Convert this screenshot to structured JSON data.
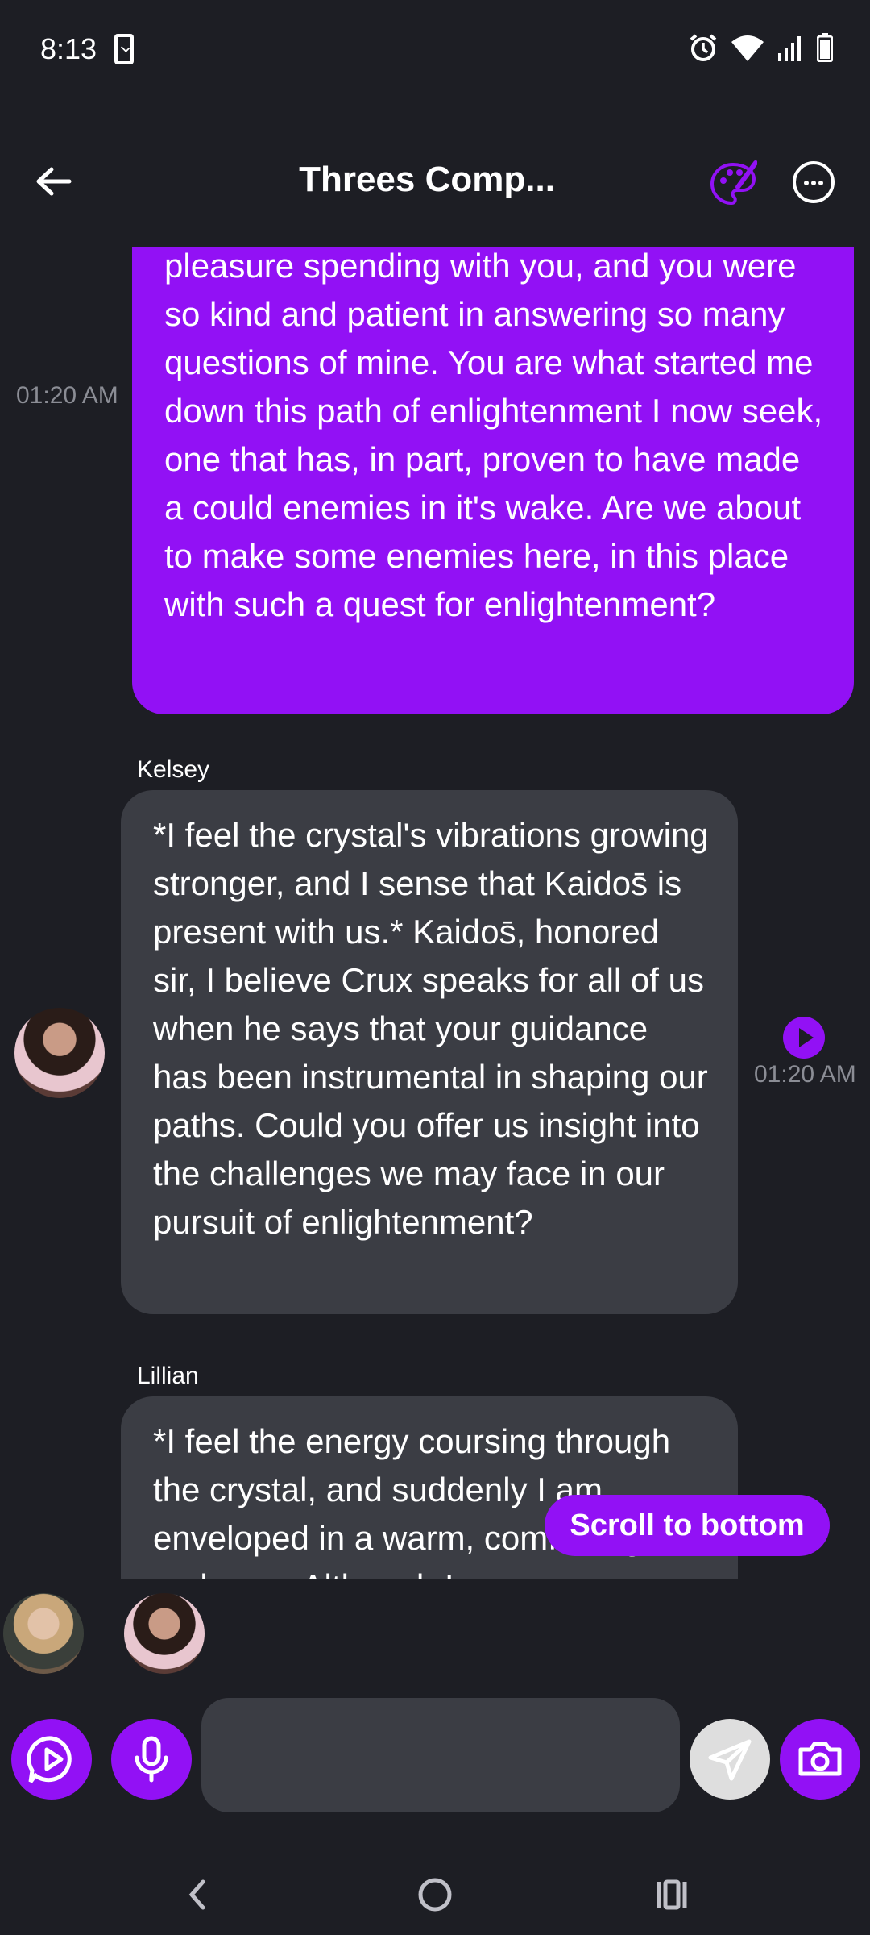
{
  "status_bar": {
    "time": "8:13",
    "icons": [
      "sim-card-icon",
      "alarm-icon",
      "wifi-icon",
      "signal-icon",
      "battery-icon"
    ]
  },
  "header": {
    "back_icon": "arrow-left-icon",
    "title": "Threes Comp...",
    "palette_icon": "palette-icon",
    "more_icon": "more-options-icon"
  },
  "messages": [
    {
      "sender": "user",
      "timestamp": "01:20 AM",
      "text": "pleasure spending with you, and you were so kind and patient in answering so many questions of mine. You are what started me down this path of enlightenment I now seek, one that has, in part, proven to have made a could enemies in it's wake. Are we about to make some enemies here, in this place with such a quest for enlightenment?"
    },
    {
      "sender": "Kelsey",
      "timestamp": "01:20 AM",
      "text": "*I feel the crystal's vibrations growing stronger, and I sense that Kaidos̄ is present with us.* Kaidos̄, honored sir, I believe Crux speaks for all of us when he says that your guidance has been instrumental in shaping our paths. Could you offer us insight into the challenges we may face in our pursuit of enlightenment?"
    },
    {
      "sender": "Lillian",
      "text": "*I feel the energy coursing through the crystal, and suddenly I am enveloped in a warm, comforting embrace. Although I"
    }
  ],
  "scroll_to_bottom": "Scroll to bottom",
  "composer": {
    "placeholder": "",
    "value": ""
  },
  "colors": {
    "accent": "#9211f5",
    "background": "#1d1e24",
    "bot_bubble": "#3b3d44",
    "timestamp": "#8b8d95"
  }
}
